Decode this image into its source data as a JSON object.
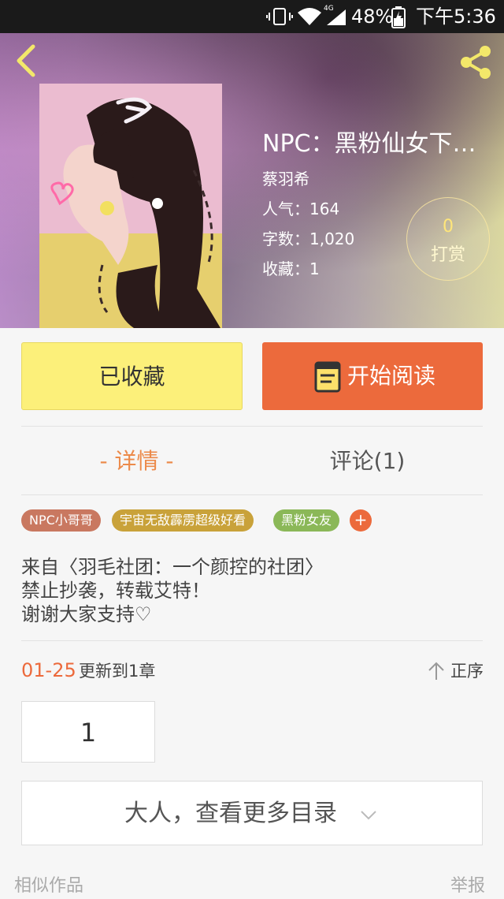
{
  "status_bar": {
    "network_label": "4G",
    "battery": "48%",
    "time": "下午5:36"
  },
  "book": {
    "title": "NPC：黑粉仙女下凡…",
    "author": "蔡羽希",
    "popularity": "人气：164",
    "word_count": "字数：1,020",
    "favorites": "收藏：1"
  },
  "reward": {
    "count": "0",
    "label": "打赏"
  },
  "actions": {
    "collect_label": "已收藏",
    "read_label": "开始阅读"
  },
  "tabs": {
    "detail": "- 详情 -",
    "comments": "评论(1)"
  },
  "tags": [
    "NPC小哥哥",
    "宇宙无敌霹雳超级好看",
    "黑粉女友"
  ],
  "add_tag": "+",
  "description": [
    "来自〈羽毛社团：一个颜控的社团〉",
    "禁止抄袭，转载艾特！",
    "谢谢大家支持♡"
  ],
  "update": {
    "date": "01-25",
    "text": "更新到1章",
    "sort_label": "正序"
  },
  "chapter_page": "1",
  "more_catalog": "大人，查看更多目录",
  "footer": {
    "similar": "相似作品",
    "report": "举报"
  },
  "colors": {
    "accent": "#ec6a3c",
    "collect_bg": "#fcf07a",
    "tag_1": "#c97860",
    "tag_2": "#c9a23a",
    "tag_3": "#8bb858"
  },
  "icons": {
    "back": "chevron-left-icon",
    "share": "share-icon",
    "read": "book-icon",
    "sort": "arrow-up-icon",
    "more": "chevron-down-icon"
  }
}
